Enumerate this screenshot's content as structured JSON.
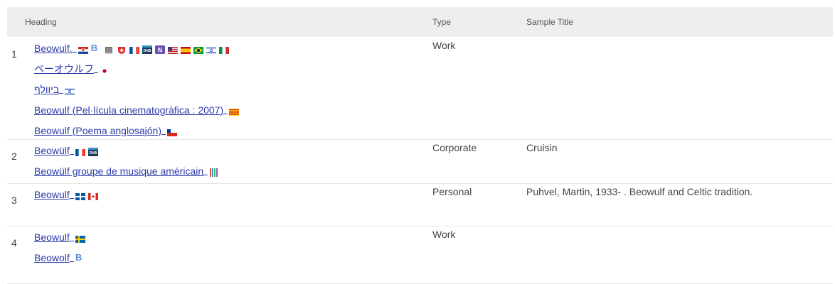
{
  "header": {
    "heading": "Heading",
    "type": "Type",
    "sample_title": "Sample Title"
  },
  "rows": [
    {
      "num": "1",
      "type": "Work",
      "sample": "",
      "headings": [
        {
          "text": "Beowulf.",
          "icons": [
            "croatia-flag-icon",
            "b-letter-icon",
            "book-icon",
            "swiss-flag-icon",
            "france-flag-icon",
            "dnb-icon",
            "n-badge-icon",
            "usa-flag-icon",
            "spain-flag-icon",
            "brazil-flag-icon",
            "israel-flag-icon",
            "italy-flag-icon"
          ]
        },
        {
          "text": "ベーオウルフ",
          "icons": [
            "japan-flag-icon"
          ]
        },
        {
          "text": "ביוולף",
          "icons": [
            "israel-flag-icon"
          ]
        },
        {
          "text": "Beowulf (Pel·lícula cinematogràfica : 2007)",
          "icons": [
            "catalonia-flag-icon"
          ]
        },
        {
          "text": "Beowulf (Poema anglosajón)",
          "icons": [
            "chile-flag-icon"
          ]
        }
      ]
    },
    {
      "num": "2",
      "type": "Corporate",
      "sample": "Cruisin",
      "headings": [
        {
          "text": "Beowülf",
          "icons": [
            "france-flag-icon",
            "dnb-icon"
          ]
        },
        {
          "text": "Beowülf groupe de musique américain",
          "icons": [
            "bars-icon"
          ]
        }
      ]
    },
    {
      "num": "3",
      "type": "Personal",
      "sample": "Puhvel, Martin, 1933- . Beowulf and Celtic tradition.",
      "headings": [
        {
          "text": "Beowulf",
          "icons": [
            "quebec-flag-icon",
            "canada-flag-icon"
          ]
        }
      ]
    },
    {
      "num": "4",
      "type": "Work",
      "sample": "",
      "headings": [
        {
          "text": "Beowulf",
          "icons": [
            "sweden-flag-icon"
          ]
        },
        {
          "text": "Beowolf",
          "icons": [
            "b-letter-icon"
          ]
        }
      ]
    }
  ],
  "colors": {
    "link": "#2b3aa8",
    "header_bg": "#eeeeee"
  }
}
